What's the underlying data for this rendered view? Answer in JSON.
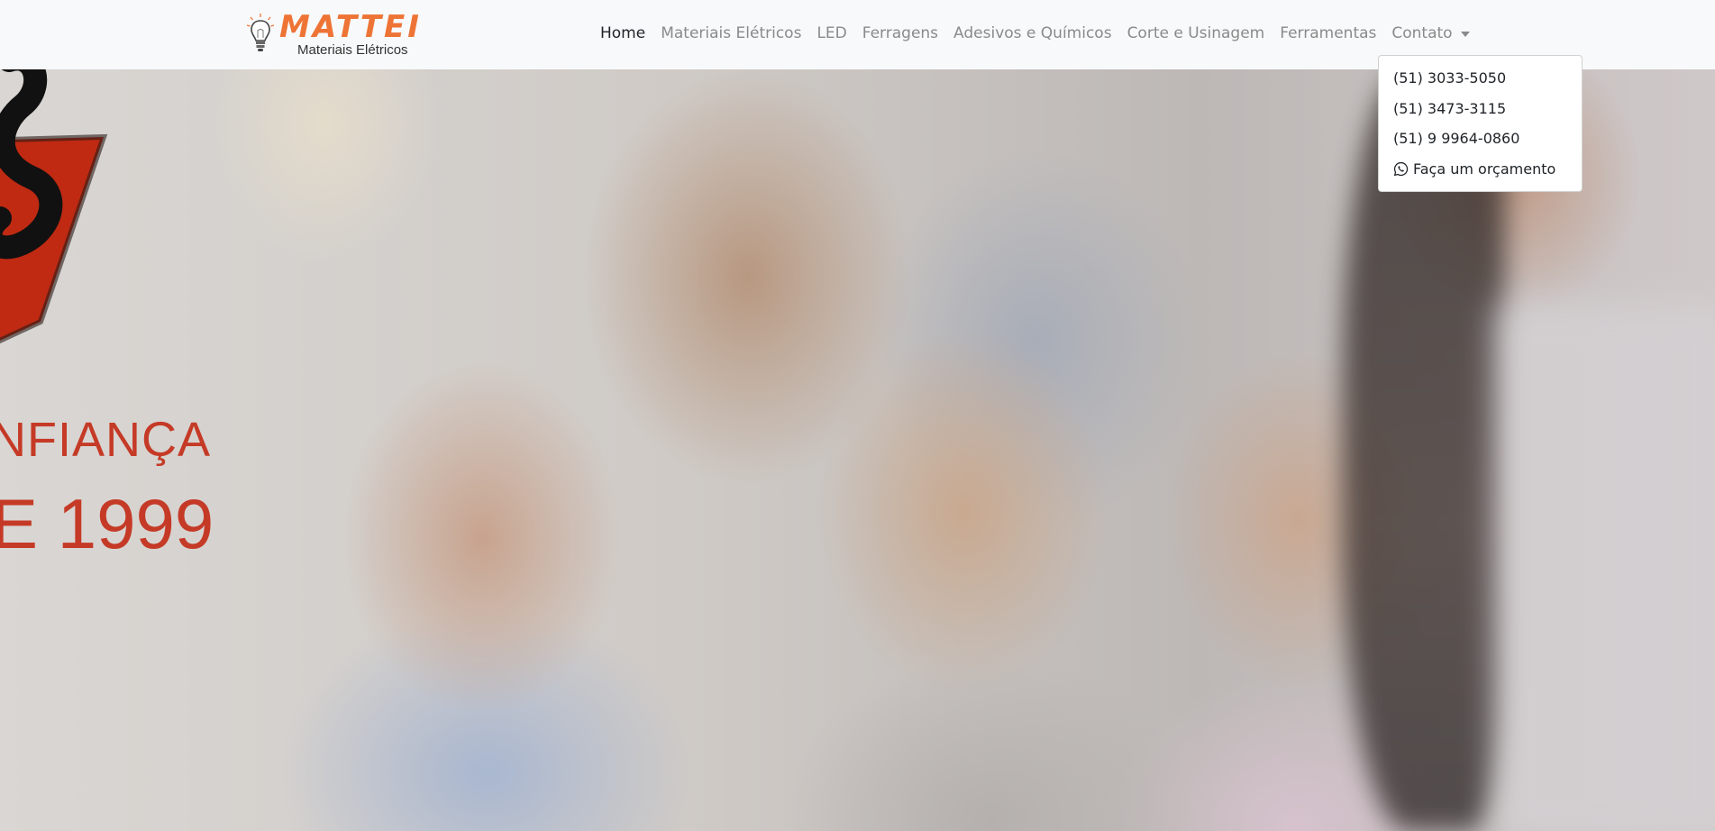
{
  "brand": {
    "name": "MATTEI",
    "subtitle": "Materiais Elétricos"
  },
  "nav": {
    "items": [
      {
        "label": "Home",
        "active": true
      },
      {
        "label": "Materiais Elétricos"
      },
      {
        "label": "LED"
      },
      {
        "label": "Ferragens"
      },
      {
        "label": "Adesivos e Químicos"
      },
      {
        "label": "Corte e Usinagem"
      },
      {
        "label": "Ferramentas"
      },
      {
        "label": "Contato",
        "dropdown": true
      }
    ]
  },
  "contact_dropdown": {
    "items": [
      {
        "label": "(51) 3033-5050"
      },
      {
        "label": "(51) 3473-3115"
      },
      {
        "label": "(51) 9 9964-0860"
      },
      {
        "label": "Faça um orçamento",
        "icon": "whatsapp-icon"
      }
    ]
  },
  "hero": {
    "line1": "NFIANÇA",
    "line2": "E 1999"
  },
  "colors": {
    "brand_orange": "#ee7436",
    "hero_red": "#c53a26",
    "navbar_bg": "#f8f9fa"
  }
}
